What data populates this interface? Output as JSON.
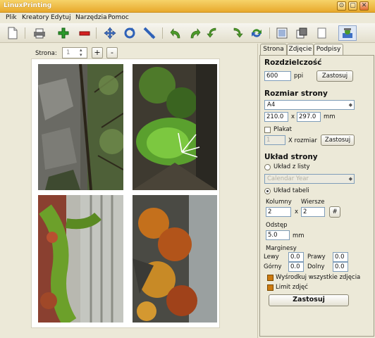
{
  "window": {
    "title": "LinuxPrinting",
    "buttons": [
      "⊙",
      "▢",
      "✕"
    ]
  },
  "menu": [
    "Plik",
    "Kreatory",
    "Edytuj",
    "Narzędzia",
    "Pomoc"
  ],
  "toolbar": {
    "icons": [
      "new-document-icon",
      "print-icon",
      "add-icon",
      "remove-icon",
      "move-icon",
      "rotate-icon",
      "crop-icon",
      "rotate-left-icon",
      "rotate-right-icon",
      "flip-left-icon",
      "flip-right-icon",
      "refresh-icon",
      "fullscreen-icon",
      "fit-icon",
      "page-icon",
      "settings-icon"
    ]
  },
  "pager": {
    "label": "Strona:",
    "value": "1",
    "add_label": "+",
    "remove_label": "-"
  },
  "tabs": [
    "Strona",
    "Zdjęcie",
    "Podpisy"
  ],
  "resolution": {
    "header": "Rozdzielczość",
    "value": "600",
    "unit": "ppi",
    "apply": "Zastosuj"
  },
  "page_size": {
    "header": "Rozmiar strony",
    "format": "A4",
    "width": "210.0",
    "x": "x",
    "height": "297.0",
    "unit": "mm",
    "poster_label": "Plakat",
    "poster_value": "1",
    "poster_x": "X rozmiar",
    "apply": "Zastosuj"
  },
  "layout": {
    "header": "Układ strony",
    "from_list_label": "Układ z listy",
    "list_value": "Calendar Year",
    "table_label": "Układ tabeli",
    "columns_label": "Kolumny",
    "rows_label": "Wiersze",
    "columns": "2",
    "rows_x": "x",
    "rows": "2",
    "hash": "#",
    "spacing_label": "Odstęp",
    "spacing": "5.0",
    "spacing_unit": "mm",
    "margins_label": "Marginesy",
    "left_label": "Lewy",
    "left": "0.0",
    "right_label": "Prawy",
    "right": "0.0",
    "top_label": "Górny",
    "top": "0.0",
    "bottom_label": "Dolny",
    "bottom": "0.0",
    "center_all": "Wyśrodkuj wszystkie zdjęcia",
    "limit": "Limit zdjęć",
    "apply": "Zastosuj"
  },
  "colors": {
    "accent": "#e8a92c",
    "checkbox": "#cc7a10"
  }
}
